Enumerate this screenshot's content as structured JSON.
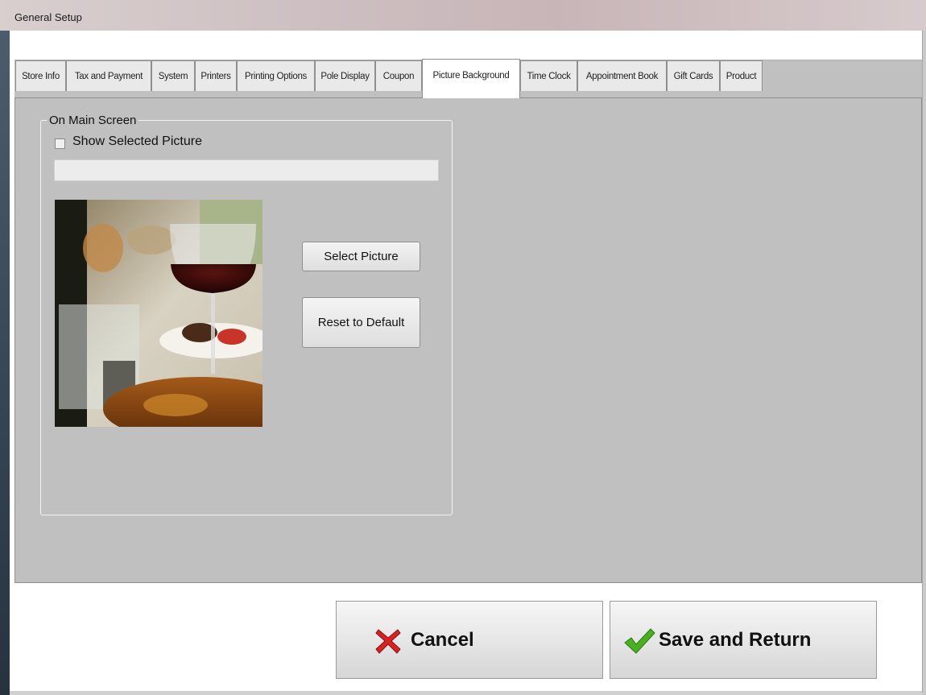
{
  "window": {
    "title": "General Setup"
  },
  "tabs": [
    {
      "label": "Store Info"
    },
    {
      "label": "Tax and Payment"
    },
    {
      "label": "System"
    },
    {
      "label": "Printers"
    },
    {
      "label": "Printing Options"
    },
    {
      "label": "Pole Display"
    },
    {
      "label": "Coupon"
    },
    {
      "label": "Picture Background"
    },
    {
      "label": "Time Clock"
    },
    {
      "label": "Appointment Book"
    },
    {
      "label": "Gift Cards"
    },
    {
      "label": "Product"
    }
  ],
  "active_tab": "Picture Background",
  "main_screen_group": {
    "legend": "On Main Screen",
    "show_picture_label": "Show Selected Picture",
    "show_picture_checked": false,
    "picture_path": "",
    "select_picture_label": "Select Picture",
    "reset_default_label": "Reset to Default"
  },
  "footer": {
    "cancel_label": "Cancel",
    "save_label": "Save and Return"
  },
  "colors": {
    "panel": "#c0c0c0",
    "cancel_icon": "#d62222",
    "save_icon": "#4caf22"
  }
}
